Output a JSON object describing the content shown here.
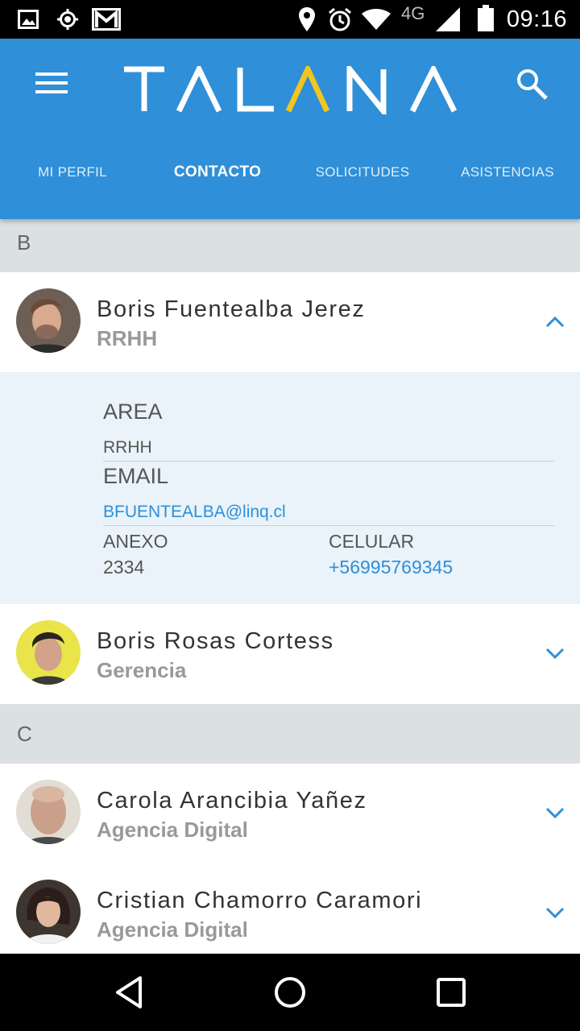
{
  "status_bar": {
    "icons": [
      "image-icon",
      "gps-icon",
      "gmail-icon",
      "location-pin-icon",
      "alarm-icon",
      "wifi-icon",
      "signal-4g-icon",
      "battery-icon"
    ],
    "network": "4G",
    "time": "09:16"
  },
  "header": {
    "logo": "TALANA",
    "logo_accent_color": "#f4c51f",
    "brand_color": "#2f8fd8",
    "tabs": [
      {
        "label": "MI PERFIL",
        "active": false
      },
      {
        "label": "CONTACTO",
        "active": true
      },
      {
        "label": "SOLICITUDES",
        "active": false
      },
      {
        "label": "ASISTENCIAS",
        "active": false
      }
    ]
  },
  "contacts": {
    "sections": [
      {
        "letter": "B",
        "items": [
          {
            "name": "Boris Fuentealba Jerez",
            "dept": "RRHH",
            "expanded": true,
            "details": {
              "area_label": "AREA",
              "area_value": "RRHH",
              "email_label": "EMAIL",
              "email_value": "BFUENTEALBA@linq.cl",
              "anexo_label": "ANEXO",
              "anexo_value": "2334",
              "celular_label": "CELULAR",
              "celular_value": "+56995769345"
            }
          },
          {
            "name": "Boris Rosas Cortess",
            "dept": "Gerencia",
            "expanded": false
          }
        ]
      },
      {
        "letter": "C",
        "items": [
          {
            "name": "Carola Arancibia Yañez",
            "dept": "Agencia Digital",
            "expanded": false
          },
          {
            "name": "Cristian Chamorro Caramori",
            "dept": "Agencia Digital",
            "expanded": false
          }
        ]
      }
    ]
  },
  "nav_bar": {
    "buttons": [
      "back-icon",
      "home-icon",
      "recents-icon"
    ]
  }
}
